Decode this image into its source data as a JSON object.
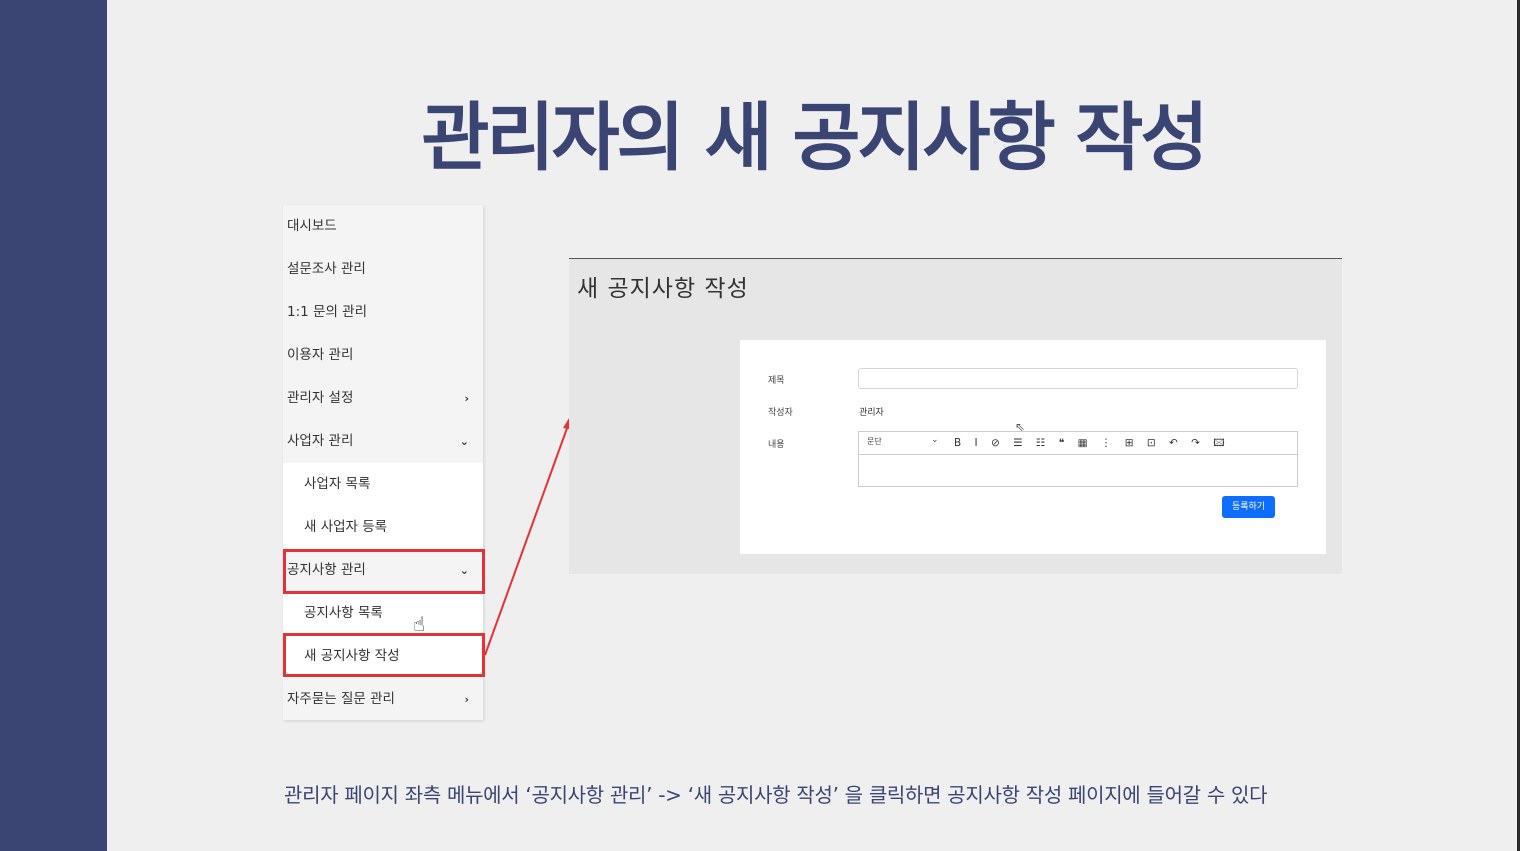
{
  "slide": {
    "title": "관리자의 새 공지사항 작성",
    "caption": "관리자 페이지 좌측 메뉴에서 ‘공지사항 관리’ -> ‘새 공지사항 작성’ 을 클릭하면 공지사항 작성 페이지에 들어갈 수 있다"
  },
  "sidebar": {
    "items": [
      {
        "label": "대시보드",
        "chevron": ""
      },
      {
        "label": "설문조사 관리",
        "chevron": ""
      },
      {
        "label": "1:1 문의 관리",
        "chevron": ""
      },
      {
        "label": "이용자 관리",
        "chevron": ""
      },
      {
        "label": "관리자 설정",
        "chevron": "›"
      },
      {
        "label": "사업자 관리",
        "chevron": "⌄"
      },
      {
        "label": "사업자 목록",
        "chevron": ""
      },
      {
        "label": "새 사업자 등록",
        "chevron": ""
      },
      {
        "label": "공지사항 관리",
        "chevron": "⌄"
      },
      {
        "label": "공지사항 목록",
        "chevron": ""
      },
      {
        "label": "새 공지사항 작성",
        "chevron": ""
      },
      {
        "label": "자주묻는 질문 관리",
        "chevron": "›"
      }
    ]
  },
  "panel": {
    "title": "새 공지사항 작성",
    "form": {
      "title_label": "제목",
      "title_value": "",
      "author_label": "작성자",
      "author_value": "관리자",
      "content_label": "내용",
      "paragraph_select": "문단",
      "toolbar_icons": "B I ⊘ ☰ ☷ ❝ ▦ ⋮ ⊞ ⊡ ↶ ↷ 🖾",
      "submit_label": "등록하기"
    }
  },
  "colors": {
    "band": "#3a4574",
    "title": "#3a4574",
    "highlight": "#e53238",
    "primary_button": "#0d6efd"
  },
  "icons": {
    "cursor": "hand-pointer-icon",
    "arrow": "red-arrow"
  }
}
